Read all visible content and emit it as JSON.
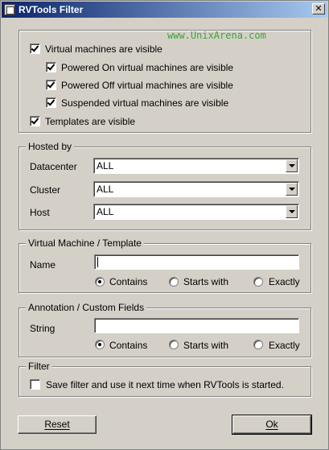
{
  "window": {
    "title": "RVTools Filter",
    "close_symbol": "✕",
    "app_icon": "window-icon"
  },
  "watermark": "www.UnixArena.com",
  "visibility": {
    "vm_visible": {
      "label": "Virtual machines are visible",
      "checked": true
    },
    "powered_on": {
      "label": "Powered On virtual machines are visible",
      "checked": true
    },
    "powered_off": {
      "label": "Powered Off virtual machines are visible",
      "checked": true
    },
    "suspended": {
      "label": "Suspended virtual machines are visible",
      "checked": true
    },
    "templates": {
      "label": "Templates are visible",
      "checked": true
    }
  },
  "hosted_by": {
    "legend": "Hosted by",
    "datacenter": {
      "label": "Datacenter",
      "value": "ALL"
    },
    "cluster": {
      "label": "Cluster",
      "value": "ALL"
    },
    "host": {
      "label": "Host",
      "value": "ALL"
    }
  },
  "vm_template": {
    "legend": "Virtual Machine / Template",
    "name_label": "Name",
    "name_value": "",
    "options": [
      "Contains",
      "Starts with",
      "Exactly"
    ],
    "selected": "Contains"
  },
  "annotation": {
    "legend": "Annotation / Custom Fields",
    "string_label": "String",
    "string_value": "",
    "options": [
      "Contains",
      "Starts with",
      "Exactly"
    ],
    "selected": "Contains"
  },
  "filter": {
    "legend": "Filter",
    "save_label": "Save filter and use it next time when RVTools is started.",
    "save_checked": false
  },
  "buttons": {
    "reset": "Reset",
    "ok": "Ok"
  }
}
